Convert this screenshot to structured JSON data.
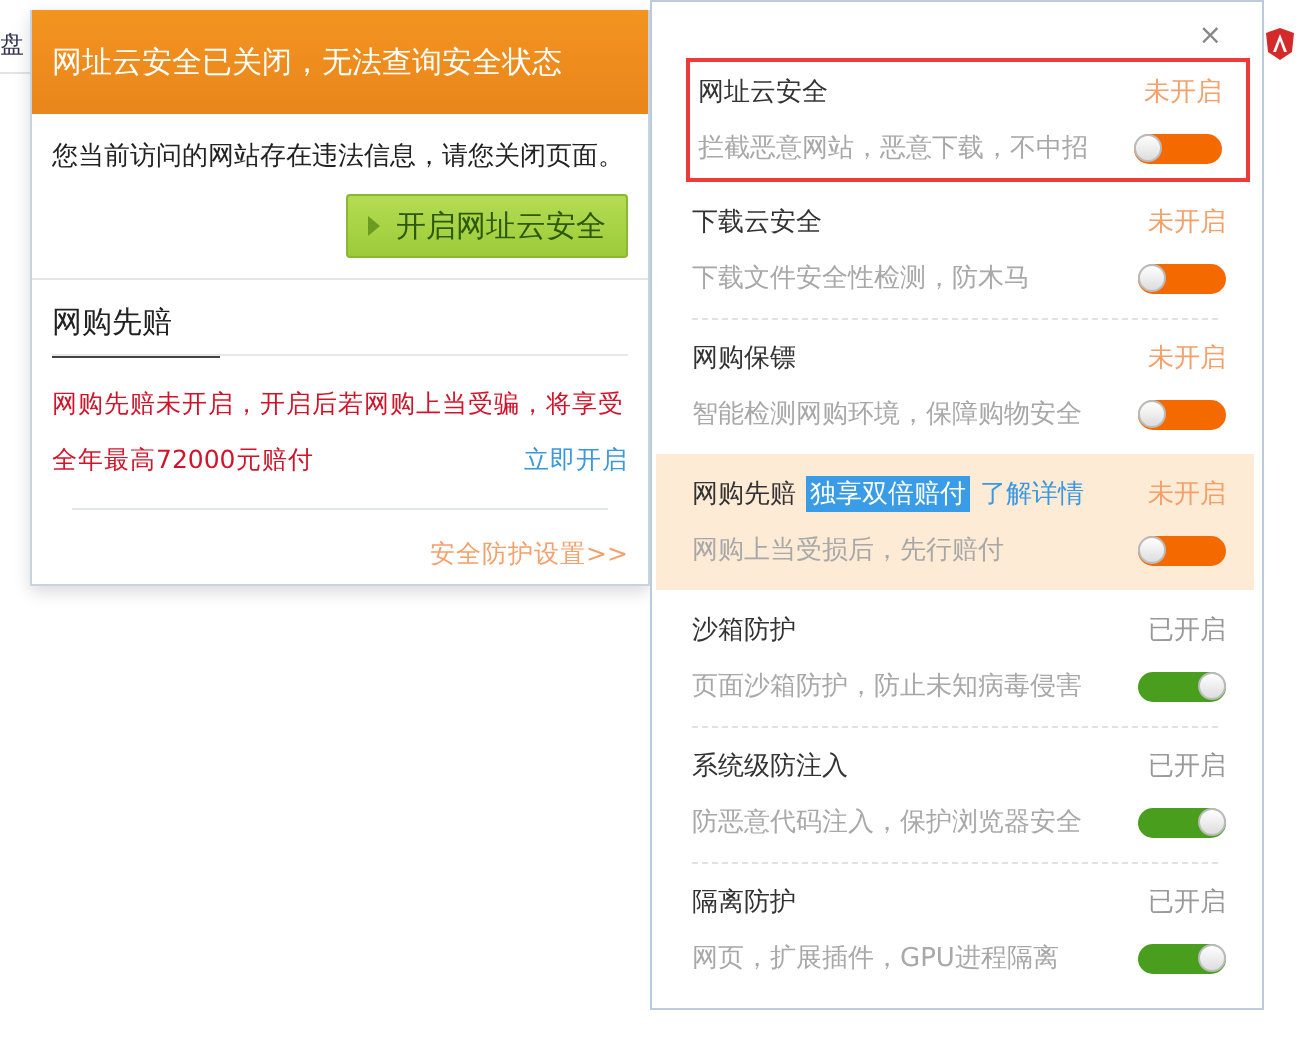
{
  "page_fragment": {
    "text": "盘"
  },
  "notice": {
    "title": "网址云安全已关闭，无法查询安全状态",
    "message": "您当前访问的网站存在违法信息，请您关闭页面。",
    "enable_button": "开启网址云安全",
    "section_title": "网购先赔",
    "warning_lines": [
      "网购先赔未开启，开启后若网购上当受骗，将享受",
      "全年最高72000元赔付"
    ],
    "enable_link": "立即开启",
    "settings_link": "安全防护设置>>"
  },
  "panel": {
    "close": "×",
    "features": [
      {
        "kind": "plain",
        "name": "网址云安全",
        "status": "未开启",
        "description": "拦截恶意网站，恶意下载，不中招",
        "on": false,
        "highlighted": true,
        "selected": false
      },
      {
        "kind": "plain",
        "name": "下载云安全",
        "status": "未开启",
        "description": "下载文件安全性检测，防木马",
        "on": false,
        "highlighted": false,
        "selected": false
      },
      {
        "kind": "plain",
        "name": "网购保镖",
        "status": "未开启",
        "description": "智能检测网购环境，保障购物安全",
        "on": false,
        "highlighted": false,
        "selected": false
      },
      {
        "kind": "promo",
        "name": "网购先赔",
        "badge": "独享双倍赔付",
        "link": "了解详情",
        "status": "未开启",
        "description": "网购上当受损后，先行赔付",
        "on": false,
        "highlighted": false,
        "selected": true
      },
      {
        "kind": "plain",
        "name": "沙箱防护",
        "status": "已开启",
        "description": "页面沙箱防护，防止未知病毒侵害",
        "on": true,
        "highlighted": false,
        "selected": false
      },
      {
        "kind": "plain",
        "name": "系统级防注入",
        "status": "已开启",
        "description": "防恶意代码注入，保护浏览器安全",
        "on": true,
        "highlighted": false,
        "selected": false
      },
      {
        "kind": "plain",
        "name": "隔离防护",
        "status": "已开启",
        "description": "网页，扩展插件，GPU进程隔离",
        "on": true,
        "highlighted": false,
        "selected": false
      }
    ]
  }
}
